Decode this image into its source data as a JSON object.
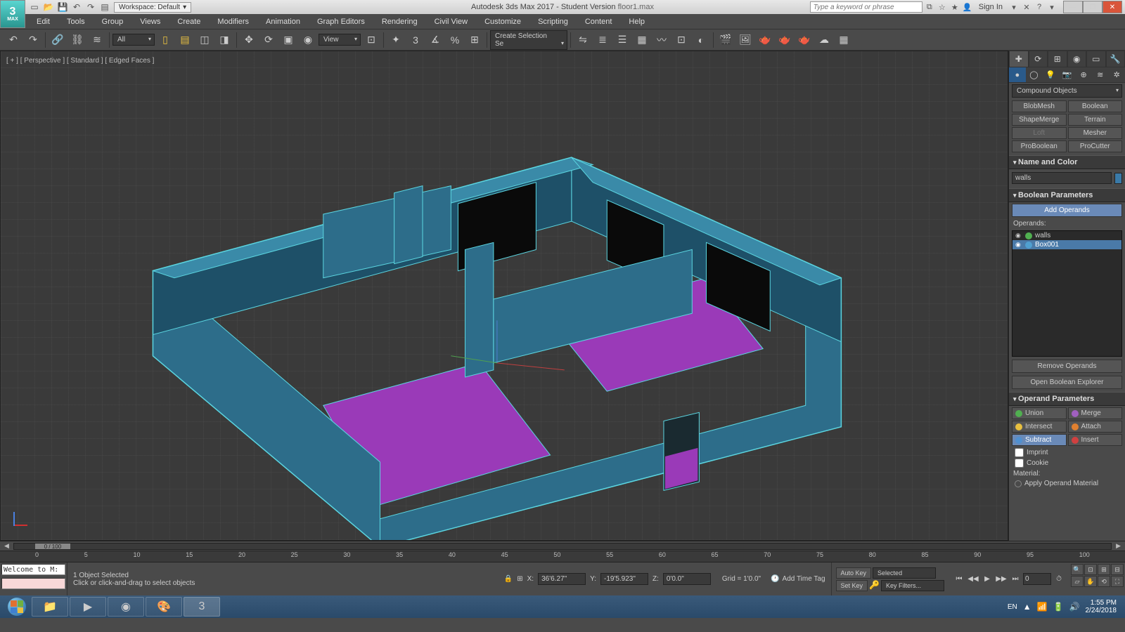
{
  "titlebar": {
    "workspace_label": "Workspace: Default",
    "app_title": "Autodesk 3ds Max 2017 - Student Version   ",
    "filename": "floor1.max",
    "search_placeholder": "Type a keyword or phrase",
    "signin": "Sign In"
  },
  "menubar": [
    "Edit",
    "Tools",
    "Group",
    "Views",
    "Create",
    "Modifiers",
    "Animation",
    "Graph Editors",
    "Rendering",
    "Civil View",
    "Customize",
    "Scripting",
    "Content",
    "Help"
  ],
  "maintoolbar": {
    "selection_filter": "All",
    "refcoord": "View",
    "named_set": "Create Selection Se"
  },
  "viewport": {
    "label": "[ + ] [ Perspective ] [ Standard ] [ Edged Faces ]"
  },
  "cmdpanel": {
    "dropdown": "Compound Objects",
    "buttons": [
      {
        "label": "BlobMesh",
        "disabled": false
      },
      {
        "label": "Boolean",
        "disabled": false
      },
      {
        "label": "ShapeMerge",
        "disabled": false
      },
      {
        "label": "Terrain",
        "disabled": false
      },
      {
        "label": "Loft",
        "disabled": true
      },
      {
        "label": "Mesher",
        "disabled": false
      },
      {
        "label": "ProBoolean",
        "disabled": false
      },
      {
        "label": "ProCutter",
        "disabled": false
      }
    ],
    "name_color_h": "Name and Color",
    "object_name": "walls",
    "bool_h": "Boolean Parameters",
    "add_operands": "Add Operands",
    "operands_label": "Operands:",
    "operands": [
      {
        "name": "walls",
        "col": "green",
        "selected": false
      },
      {
        "name": "Box001",
        "col": "blue",
        "selected": true
      }
    ],
    "remove_operands": "Remove Operands",
    "open_explorer": "Open Boolean Explorer",
    "operand_h": "Operand Parameters",
    "ops": [
      {
        "name": "Union",
        "color": "#50b050",
        "active": false
      },
      {
        "name": "Merge",
        "color": "#a060c0",
        "active": false
      },
      {
        "name": "Intersect",
        "color": "#e8c040",
        "active": false
      },
      {
        "name": "Attach",
        "color": "#e08030",
        "active": false
      },
      {
        "name": "Subtract",
        "color": "#5090d0",
        "active": true
      },
      {
        "name": "Insert",
        "color": "#d04040",
        "active": false
      }
    ],
    "imprint": "Imprint",
    "cookie": "Cookie",
    "material_label": "Material:",
    "apply_material": "Apply Operand Material"
  },
  "trackbar": {
    "frame": "0 / 100"
  },
  "timeline_ticks": [
    "0",
    "5",
    "10",
    "15",
    "20",
    "25",
    "30",
    "35",
    "40",
    "45",
    "50",
    "55",
    "60",
    "65",
    "70",
    "75",
    "80",
    "85",
    "90",
    "95",
    "100"
  ],
  "status": {
    "maxscript": "Welcome to M:",
    "selected": "1 Object Selected",
    "prompt": "Click or click-and-drag to select objects",
    "x": "36'6.27\"",
    "y": "-19'5.923\"",
    "z": "0'0.0\"",
    "grid": "Grid = 1'0.0\"",
    "timetag": "Add Time Tag",
    "autokey": "Auto Key",
    "setkey": "Set Key",
    "selected_mode": "Selected",
    "keyfilters": "Key Filters...",
    "frame_spin": "0"
  },
  "taskbar": {
    "lang": "EN",
    "time": "1:55 PM",
    "date": "2/24/2018"
  }
}
